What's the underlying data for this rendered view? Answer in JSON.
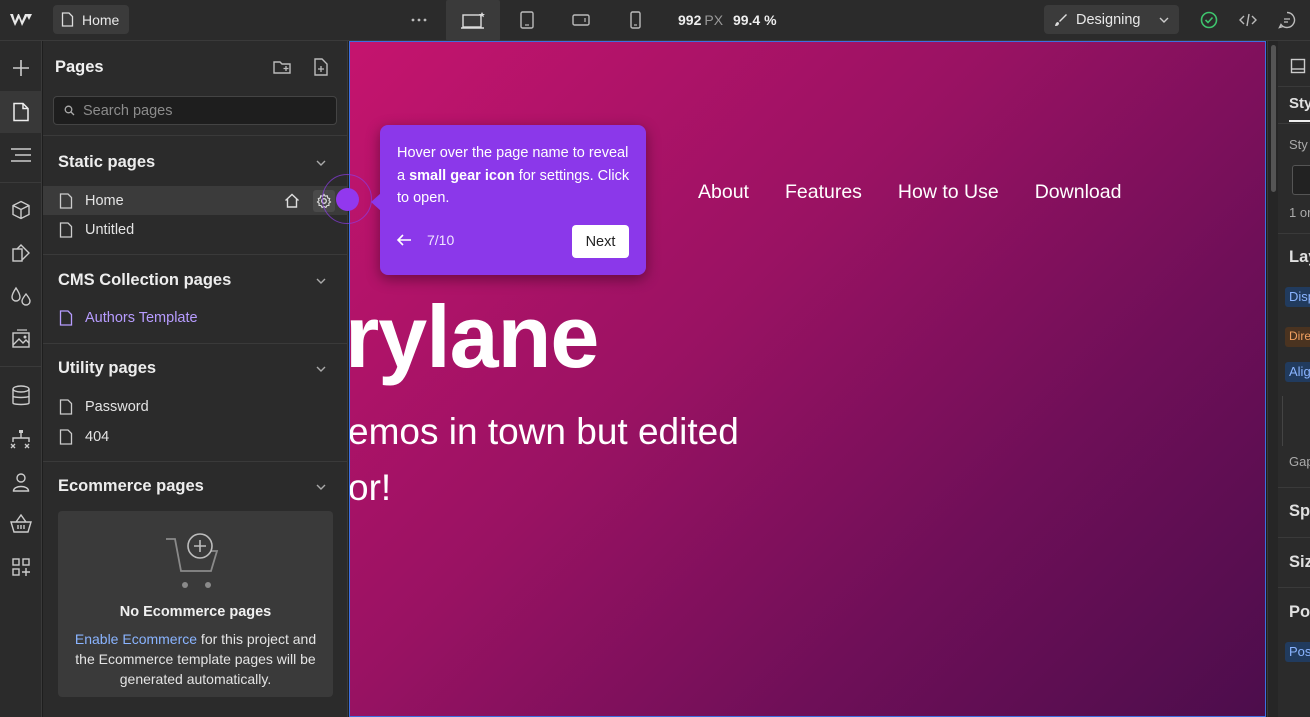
{
  "topbar": {
    "page_name": "Home",
    "width_value": "992",
    "width_unit": "PX",
    "zoom": "99.4 %",
    "mode_label": "Designing",
    "icons": [
      "webflow-logo-icon",
      "page-icon",
      "more-icon",
      "desktop-base-icon",
      "tablet-icon",
      "mobile-landscape-icon",
      "mobile-portrait-icon",
      "brush-icon",
      "chevron-down-icon",
      "check-circle-icon",
      "code-icon",
      "comment-icon"
    ]
  },
  "rail": {
    "icons": [
      "add-icon",
      "pages-icon",
      "navigator-icon",
      "components-icon",
      "variables-icon",
      "styles-icon",
      "assets-icon",
      "cms-icon",
      "logic-icon",
      "users-icon",
      "ecommerce-icon",
      "apps-icon"
    ]
  },
  "panel": {
    "title": "Pages",
    "search_placeholder": "Search pages",
    "sections": {
      "static": {
        "title": "Static pages",
        "items": [
          "Home",
          "Untitled"
        ]
      },
      "cms": {
        "title": "CMS Collection pages",
        "items": [
          "Authors Template"
        ]
      },
      "utility": {
        "title": "Utility pages",
        "items": [
          "Password",
          "404"
        ]
      },
      "ecommerce": {
        "title": "Ecommerce pages",
        "empty_title": "No Ecommerce pages",
        "empty_link": "Enable Ecommerce",
        "empty_desc": " for this project and the Ecommerce template pages will be generated automatically."
      }
    }
  },
  "canvas": {
    "nav": [
      "About",
      "Features",
      "How to Use",
      "Download"
    ],
    "hero_title": "rylane",
    "hero_line1": "emos in town but edited",
    "hero_line2": "or!"
  },
  "right_panel": {
    "texts": [
      "Sty",
      "Sty",
      "1 or",
      "Lay",
      "Disp",
      "Dire",
      "Alig",
      "Gap",
      "Spa",
      "Siz",
      "Pos",
      "Pos"
    ]
  },
  "tour": {
    "text_before": "Hover over the page name to reveal a ",
    "text_bold": "small gear icon",
    "text_after": " for settings. Click to open.",
    "step": "7/10",
    "next_label": "Next"
  },
  "colors": {
    "accent": "#8b38ea",
    "canvas_gradient_start": "#c5146e",
    "canvas_gradient_end": "#4c0d4c",
    "link": "#8ab4ff",
    "cms_item": "#b79cff"
  }
}
